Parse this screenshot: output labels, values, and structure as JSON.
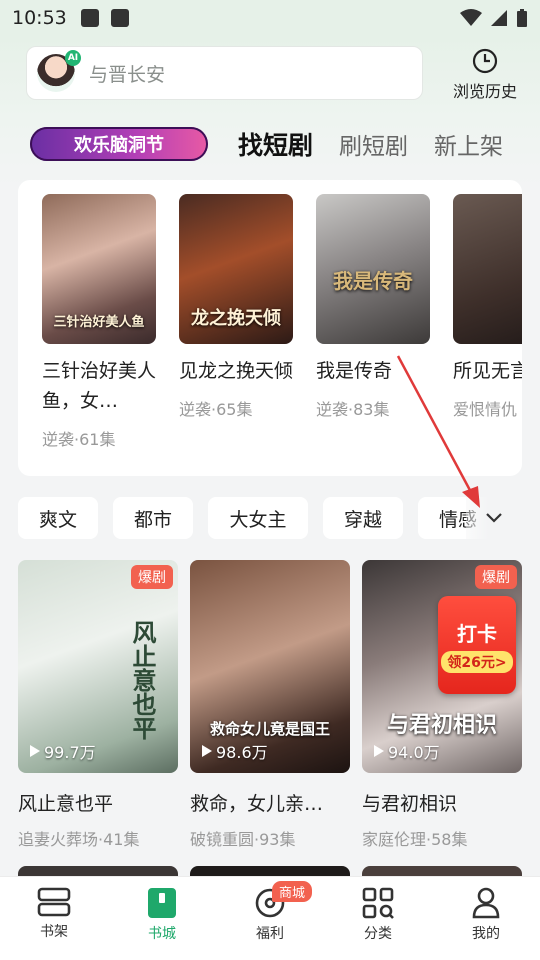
{
  "status": {
    "time": "10:53"
  },
  "search": {
    "placeholder": "与晋长安",
    "ai_badge": "AI"
  },
  "history": {
    "label": "浏览历史"
  },
  "tabs": {
    "festival": "欢乐脑洞节",
    "items": [
      "找短剧",
      "刷短剧",
      "新上架"
    ]
  },
  "featured": [
    {
      "title": "三针治好美人鱼，女…",
      "meta": "逆袭·61集",
      "poster_text": "三针治好美人鱼"
    },
    {
      "title": "见龙之挽天倾",
      "meta": "逆袭·65集",
      "poster_text": "龙之挽天倾"
    },
    {
      "title": "我是传奇",
      "meta": "逆袭·83集",
      "poster_text": "我是传奇"
    },
    {
      "title": "所见无言",
      "meta": "爱恨情仇",
      "poster_text": ""
    }
  ],
  "genres": [
    "爽文",
    "都市",
    "大女主",
    "穿越",
    "情感"
  ],
  "grid": [
    {
      "title": "风止意也平",
      "meta": "追妻火葬场·41集",
      "plays": "99.7万",
      "badge": "爆剧",
      "poster_text": "风止意也平"
    },
    {
      "title": "救命，女儿亲…",
      "meta": "破镜重圆·93集",
      "plays": "98.6万",
      "badge": "",
      "poster_text": "救命女儿竟是国王"
    },
    {
      "title": "与君初相识",
      "meta": "家庭伦理·58集",
      "plays": "94.0万",
      "badge": "爆剧",
      "poster_text": "与君初相识"
    }
  ],
  "promo": {
    "line1": "打卡",
    "line2": "领26元>"
  },
  "bottom_nav": [
    {
      "label": "书架",
      "icon": "bookshelf-icon"
    },
    {
      "label": "书城",
      "icon": "bookstore-icon"
    },
    {
      "label": "福利",
      "icon": "welfare-icon",
      "badge": "商城"
    },
    {
      "label": "分类",
      "icon": "category-icon"
    },
    {
      "label": "我的",
      "icon": "profile-icon"
    }
  ],
  "colors": {
    "accent": "#1fa86b",
    "badge": "#f2614f",
    "annotation": "#e03a3a"
  }
}
